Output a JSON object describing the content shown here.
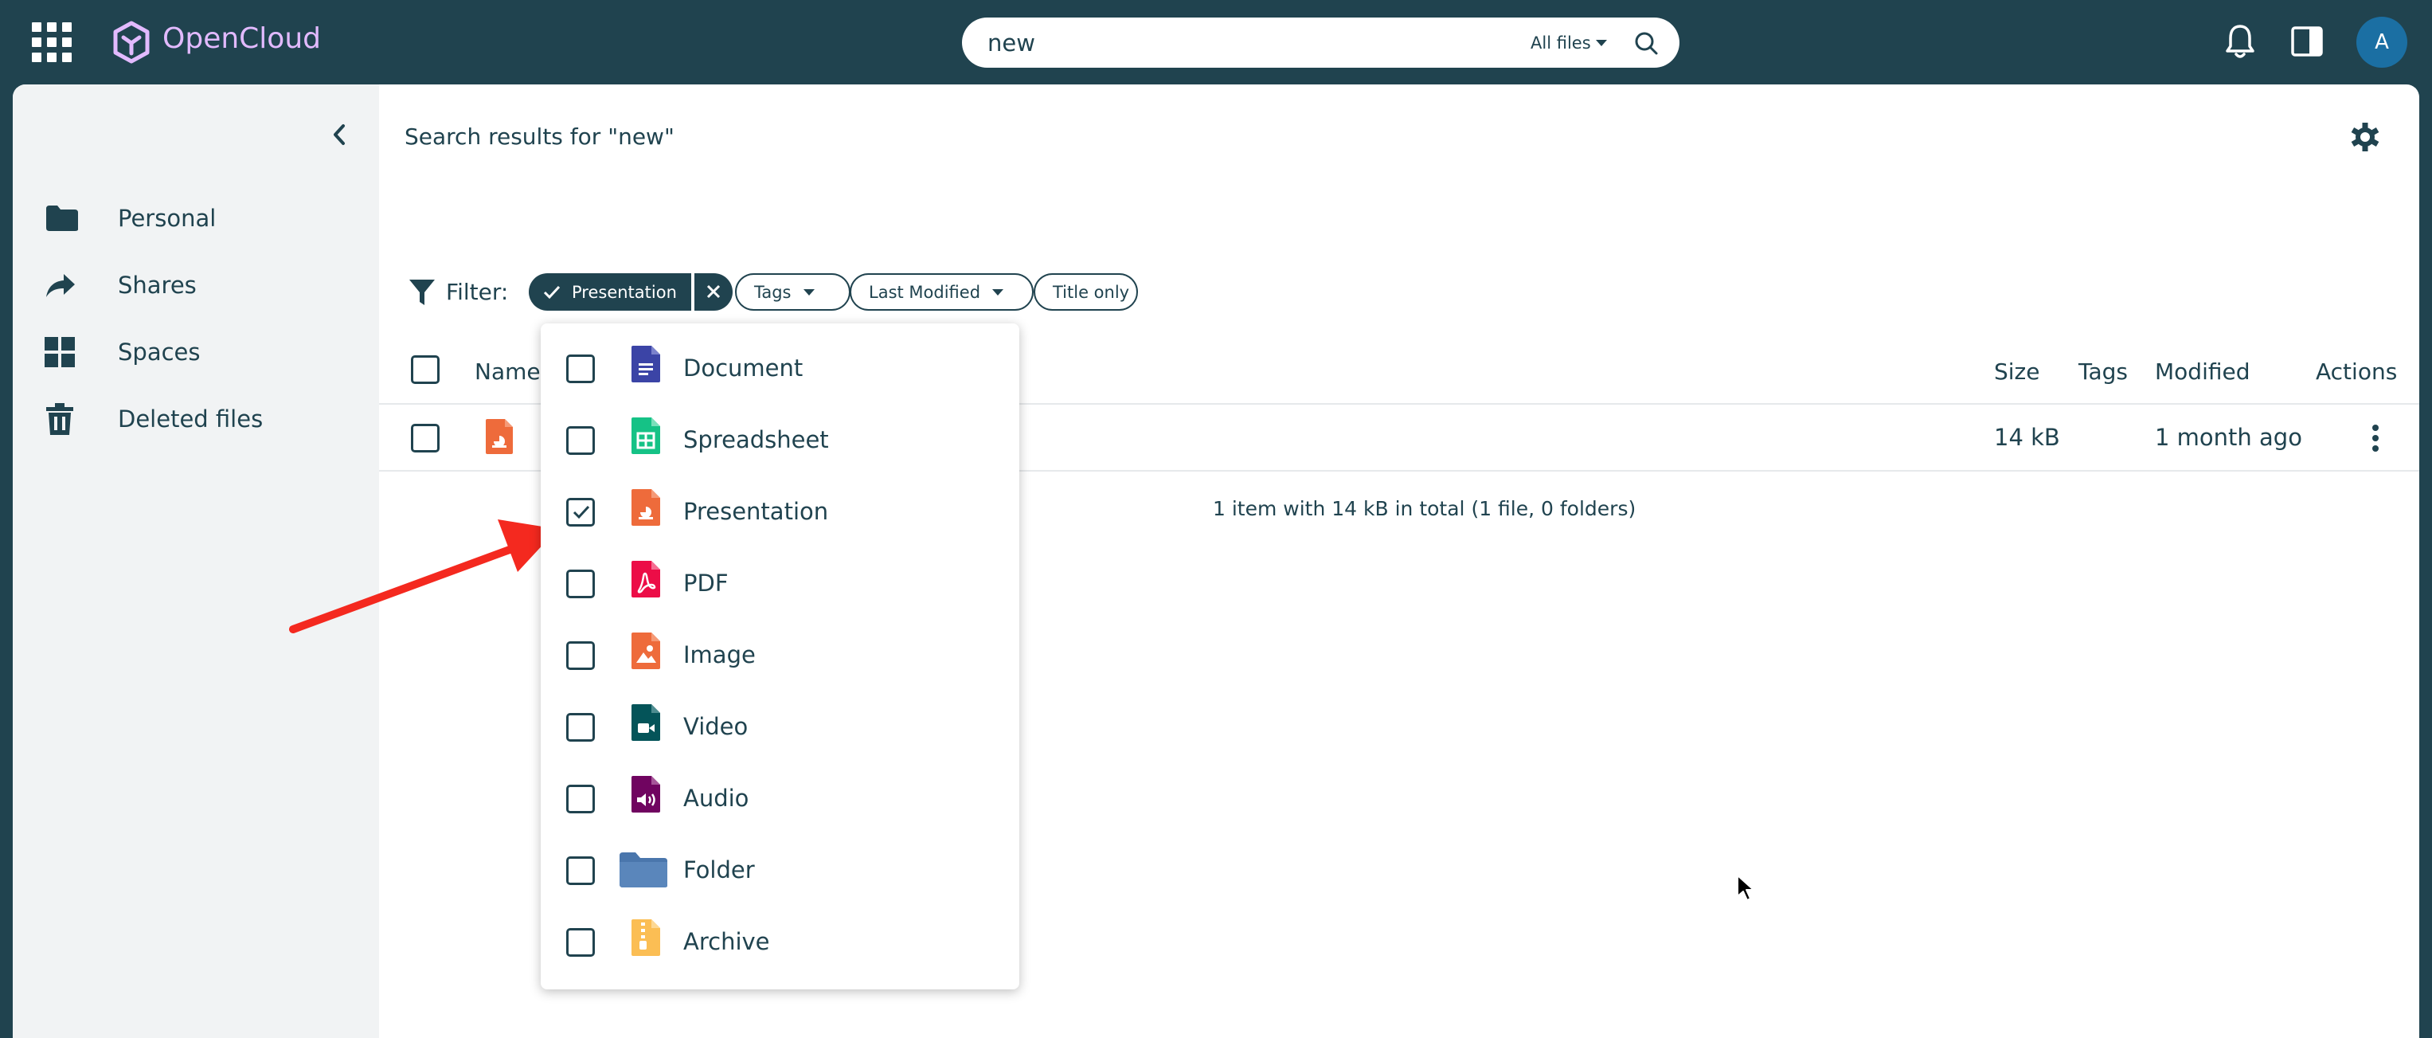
{
  "app": {
    "name": "OpenCloud",
    "brand_color": "#20434f",
    "accent_color": "#e2baff"
  },
  "topbar": {
    "search_value": "new",
    "search_scope": "All files",
    "avatar_initial": "A",
    "icons": [
      "app-switcher-icon",
      "notifications-bell-icon",
      "sidebar-toggle-icon",
      "search-icon"
    ]
  },
  "sidebar": {
    "items": [
      {
        "label": "Personal",
        "icon": "folder-icon"
      },
      {
        "label": "Shares",
        "icon": "share-arrow-icon"
      },
      {
        "label": "Spaces",
        "icon": "spaces-grid-icon"
      },
      {
        "label": "Deleted files",
        "icon": "trash-icon"
      }
    ]
  },
  "main": {
    "title": "Search results for \"new\"",
    "filter_label": "Filter:",
    "filters": {
      "type_active": "Presentation",
      "tags": "Tags",
      "last_modified": "Last Modified",
      "title_only": "Title only"
    },
    "table": {
      "headers": {
        "name": "Name",
        "size": "Size",
        "tags": "Tags",
        "modified": "Modified",
        "actions": "Actions"
      },
      "rows": [
        {
          "name": "",
          "size": "14 kB",
          "tags": "",
          "modified": "1 month ago",
          "type": "Presentation"
        }
      ]
    },
    "footer": "1 item with 14 kB in total (1 file, 0 folders)"
  },
  "type_filter_menu": {
    "items": [
      {
        "label": "Document",
        "checked": false,
        "color": "#3b44a6"
      },
      {
        "label": "Spreadsheet",
        "checked": false,
        "color": "#15c286"
      },
      {
        "label": "Presentation",
        "checked": true,
        "color": "#ee6b3b"
      },
      {
        "label": "PDF",
        "checked": false,
        "color": "#ec0d47"
      },
      {
        "label": "Image",
        "checked": false,
        "color": "#ee6b3b"
      },
      {
        "label": "Video",
        "checked": false,
        "color": "#045459"
      },
      {
        "label": "Audio",
        "checked": false,
        "color": "#700460"
      },
      {
        "label": "Folder",
        "checked": false,
        "color": "#4a76ac"
      },
      {
        "label": "Archive",
        "checked": false,
        "color": "#fbbe54"
      }
    ]
  },
  "annotation": {
    "arrow_color": "#f4291f"
  }
}
